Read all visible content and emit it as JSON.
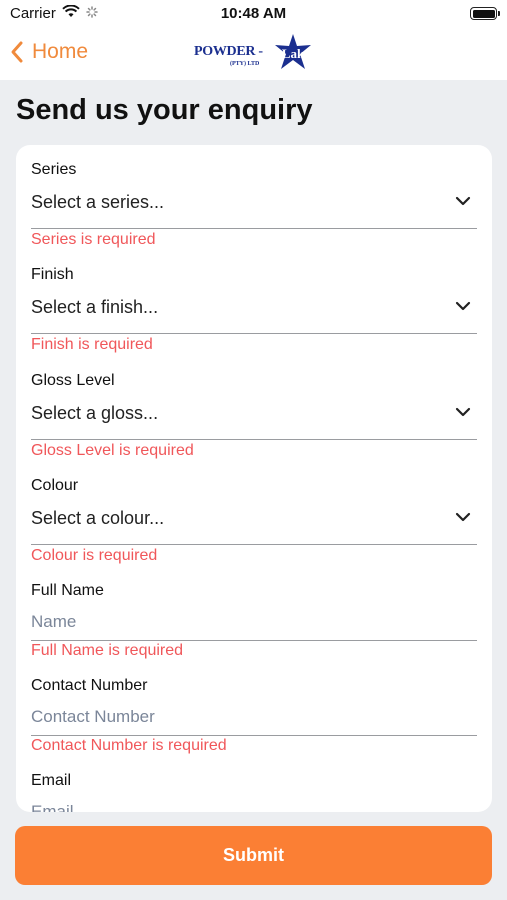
{
  "status_bar": {
    "carrier": "Carrier",
    "time": "10:48 AM"
  },
  "nav": {
    "back_label": "Home",
    "logo_text": "POWDER - ",
    "logo_mark_text": "Lak",
    "logo_sub": "(PTY) LTD"
  },
  "page_title": "Send us your enquiry",
  "form": {
    "series": {
      "label": "Series",
      "value": "Select a series...",
      "error": "Series is required"
    },
    "finish": {
      "label": "Finish",
      "value": "Select a finish...",
      "error": "Finish is required"
    },
    "gloss": {
      "label": "Gloss Level",
      "value": "Select a gloss...",
      "error": "Gloss Level is required"
    },
    "colour": {
      "label": "Colour",
      "value": "Select a colour...",
      "error": "Colour is required"
    },
    "full_name": {
      "label": "Full Name",
      "placeholder": "Name",
      "error": "Full Name is required"
    },
    "contact_number": {
      "label": "Contact Number",
      "placeholder": "Contact Number",
      "error": "Contact Number is required"
    },
    "email": {
      "label": "Email",
      "placeholder": "Email"
    }
  },
  "submit_label": "Submit",
  "colors": {
    "accent": "#fb7f34",
    "back": "#f08a3c",
    "error": "#f0575a",
    "logo_blue": "#1b2f8f"
  }
}
